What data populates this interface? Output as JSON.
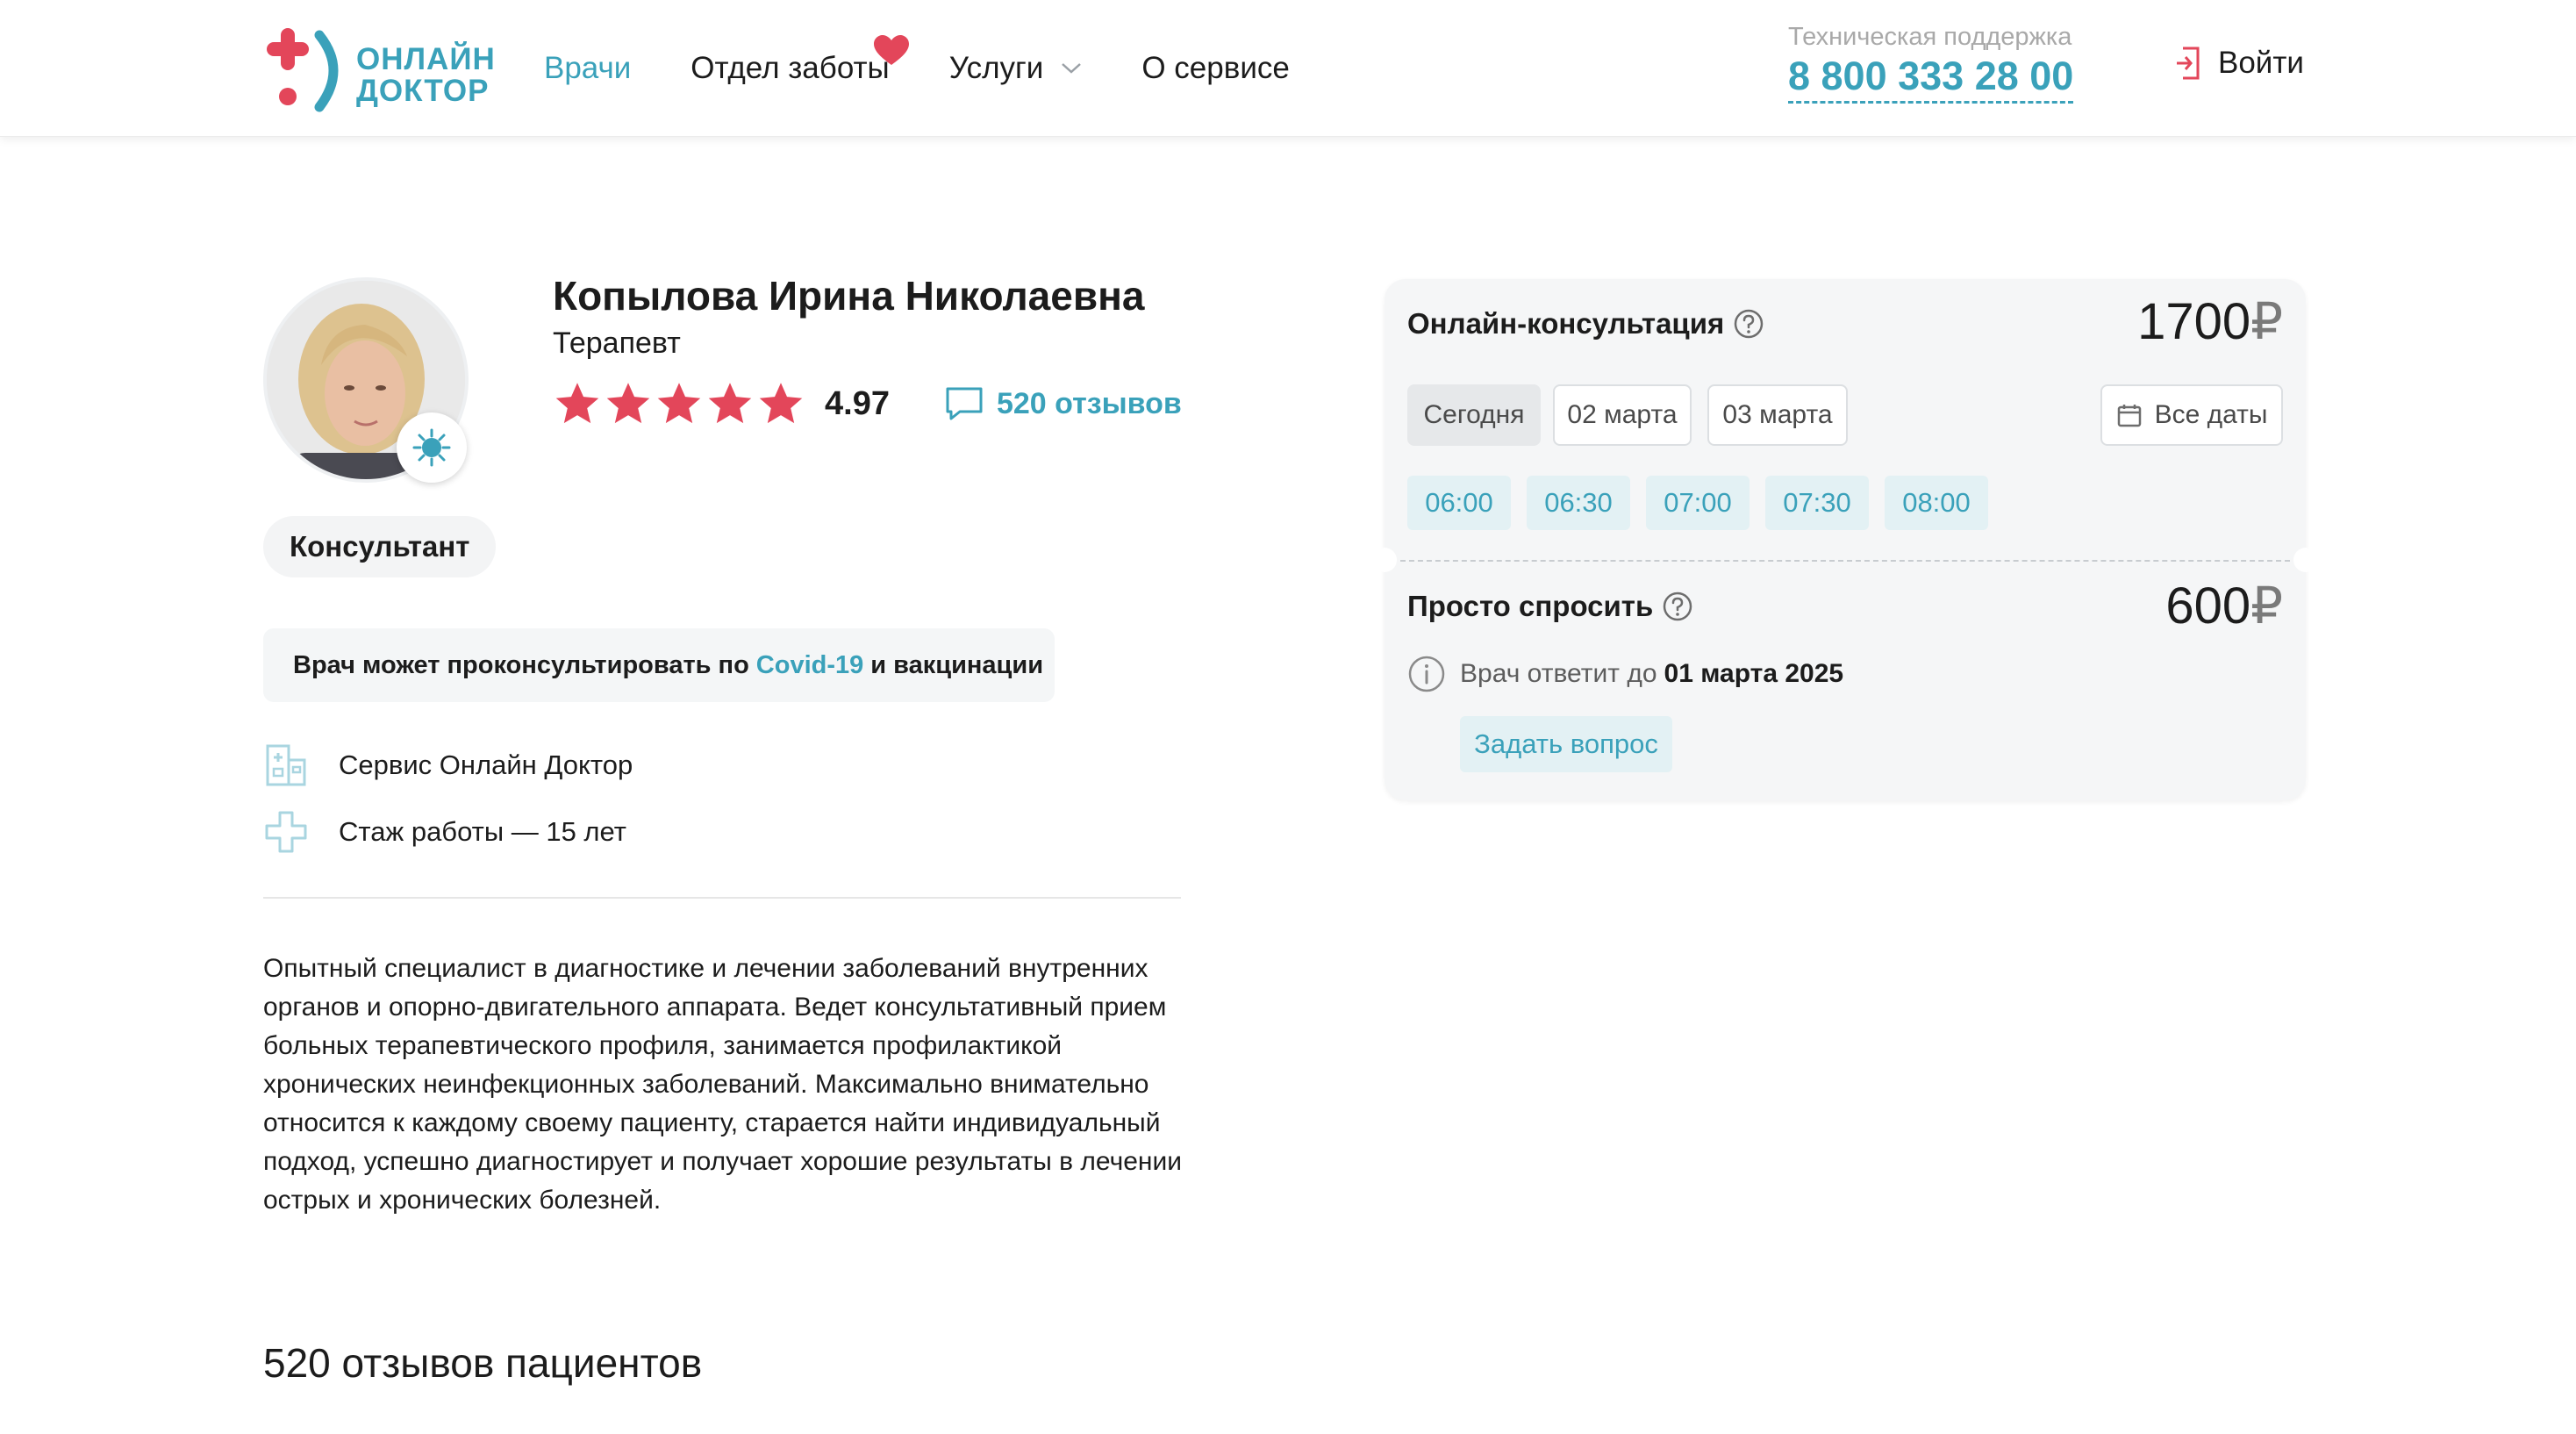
{
  "brand": {
    "line1": "ОНЛАЙН",
    "line2": "ДОКТОР"
  },
  "nav": {
    "items": [
      {
        "label": "Врачи"
      },
      {
        "label": "Отдел заботы"
      },
      {
        "label": "Услуги"
      },
      {
        "label": "О сервисе"
      }
    ]
  },
  "support": {
    "label": "Техническая поддержка",
    "phone": "8 800 333 28 00"
  },
  "login": {
    "label": "Войти"
  },
  "doctor": {
    "name": "Копылова Ирина Николаевна",
    "specialty": "Терапевт",
    "rating": "4.97",
    "stars": 5,
    "reviews_link": "520 отзывов",
    "badge": "Консультант",
    "covid": {
      "before": "Врач может проконсультировать по",
      "highlight": "Covid-19",
      "after": "и вакцинации"
    },
    "service": "Сервис Онлайн Доктор",
    "experience": "Стаж работы — 15 лет",
    "about": "Опытный специалист в диагностике и лечении заболеваний внутренних органов и опорно-двигательного аппарата. Ведет консультативный прием больных терапевтического профиля, занимается профилактикой хронических неинфекционных заболеваний. Максимально внимательно относится к каждому своему пациенту, старается найти индивидуальный подход, успешно диагностирует и получает хорошие результаты в лечении острых и хронических болезней."
  },
  "consultation": {
    "title": "Онлайн-консультация",
    "price": "1700",
    "currency": "₽",
    "dates": [
      {
        "label": "Сегодня"
      },
      {
        "label": "02 марта"
      },
      {
        "label": "03 марта"
      }
    ],
    "all_dates": "Все даты",
    "slots": [
      "06:00",
      "06:30",
      "07:00",
      "07:30",
      "08:00"
    ]
  },
  "ask": {
    "title": "Просто спросить",
    "price": "600",
    "currency": "₽",
    "answer_text": "Врач ответит до",
    "answer_date": "01 марта 2025",
    "button": "Задать вопрос"
  },
  "reviews_section": {
    "title": "520 отзывов пациентов"
  },
  "colors": {
    "accent": "#3aa1ba",
    "brand_red": "#e3465a",
    "star": "#e3465a"
  }
}
